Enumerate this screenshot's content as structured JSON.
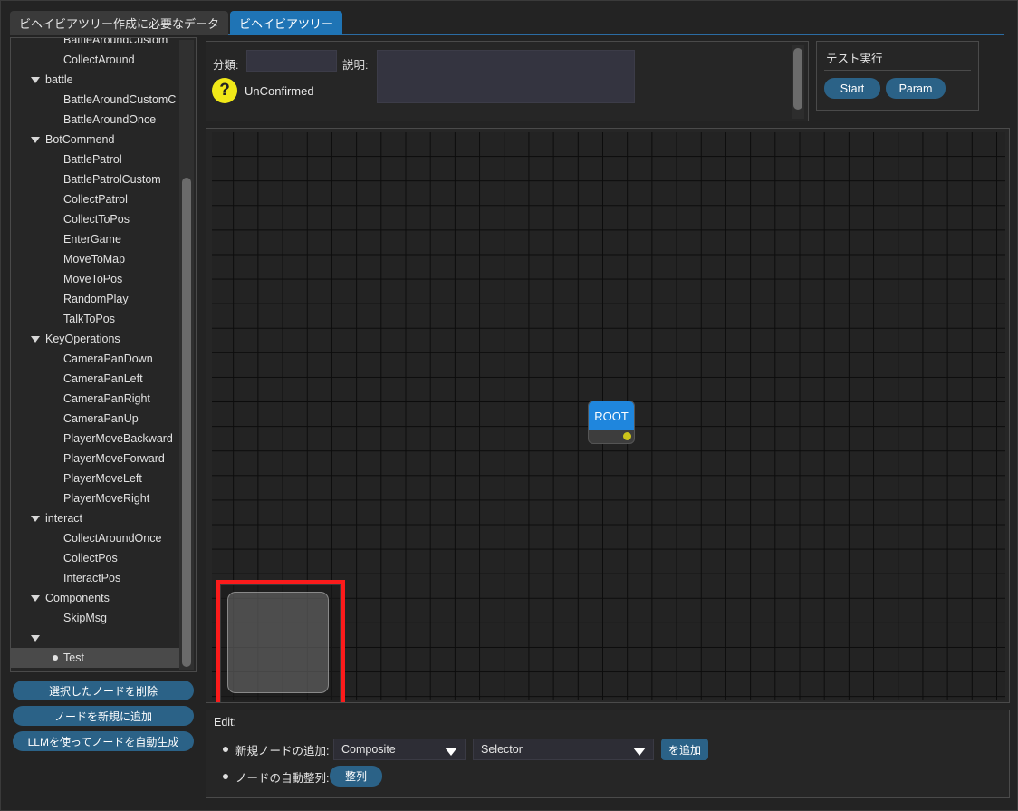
{
  "tabs": [
    {
      "label": "ビヘイビアツリー作成に必要なデータ",
      "active": false
    },
    {
      "label": "ビヘイビアツリー",
      "active": true
    }
  ],
  "tree": {
    "nodes": [
      {
        "label": "BattleAroundCustom",
        "type": "leaf"
      },
      {
        "label": "CollectAround",
        "type": "leaf"
      },
      {
        "label": "battle",
        "type": "group"
      },
      {
        "label": "BattleAroundCustomC",
        "type": "leaf"
      },
      {
        "label": "BattleAroundOnce",
        "type": "leaf"
      },
      {
        "label": "BotCommend",
        "type": "group"
      },
      {
        "label": "BattlePatrol",
        "type": "leaf"
      },
      {
        "label": "BattlePatrolCustom",
        "type": "leaf"
      },
      {
        "label": "CollectPatrol",
        "type": "leaf"
      },
      {
        "label": "CollectToPos",
        "type": "leaf"
      },
      {
        "label": "EnterGame",
        "type": "leaf"
      },
      {
        "label": "MoveToMap",
        "type": "leaf"
      },
      {
        "label": "MoveToPos",
        "type": "leaf"
      },
      {
        "label": "RandomPlay",
        "type": "leaf"
      },
      {
        "label": "TalkToPos",
        "type": "leaf"
      },
      {
        "label": "KeyOperations",
        "type": "group"
      },
      {
        "label": "CameraPanDown",
        "type": "leaf"
      },
      {
        "label": "CameraPanLeft",
        "type": "leaf"
      },
      {
        "label": "CameraPanRight",
        "type": "leaf"
      },
      {
        "label": "CameraPanUp",
        "type": "leaf"
      },
      {
        "label": "PlayerMoveBackward",
        "type": "leaf"
      },
      {
        "label": "PlayerMoveForward",
        "type": "leaf"
      },
      {
        "label": "PlayerMoveLeft",
        "type": "leaf"
      },
      {
        "label": "PlayerMoveRight",
        "type": "leaf"
      },
      {
        "label": "interact",
        "type": "group"
      },
      {
        "label": "CollectAroundOnce",
        "type": "leaf"
      },
      {
        "label": "CollectPos",
        "type": "leaf"
      },
      {
        "label": "InteractPos",
        "type": "leaf"
      },
      {
        "label": "Components",
        "type": "group"
      },
      {
        "label": "SkipMsg",
        "type": "leaf"
      },
      {
        "label": "",
        "type": "group"
      },
      {
        "label": "Test",
        "type": "selected"
      }
    ]
  },
  "sidebar_buttons": {
    "delete_node": "選択したノードを削除",
    "add_node": "ノードを新規に追加",
    "llm_generate": "LLMを使ってノードを自動生成"
  },
  "info": {
    "category_label": "分類:",
    "category_value": "",
    "category_placeholder": "",
    "description_label": "説明:",
    "description_value": "",
    "description_placeholder": "",
    "status_icon": "question-mark",
    "status_text": "UnConfirmed",
    "status_color": "#f0e818"
  },
  "test_panel": {
    "title": "テスト実行",
    "start_label": "Start",
    "param_label": "Param"
  },
  "canvas": {
    "root_node_label": "ROOT",
    "root_node_color": "#1f86dd",
    "root_body_color": "#3d3d3d",
    "root_port_color": "#ccc41a",
    "minimap_highlight_color": "#fb1b1b"
  },
  "edit": {
    "title": "Edit:",
    "add_node_label": "新規ノードの追加:",
    "node_category_value": "Composite",
    "node_type_value": "Selector",
    "add_button_label": "を追加",
    "auto_align_label": "ノードの自動整列:",
    "align_button_label": "整列"
  }
}
